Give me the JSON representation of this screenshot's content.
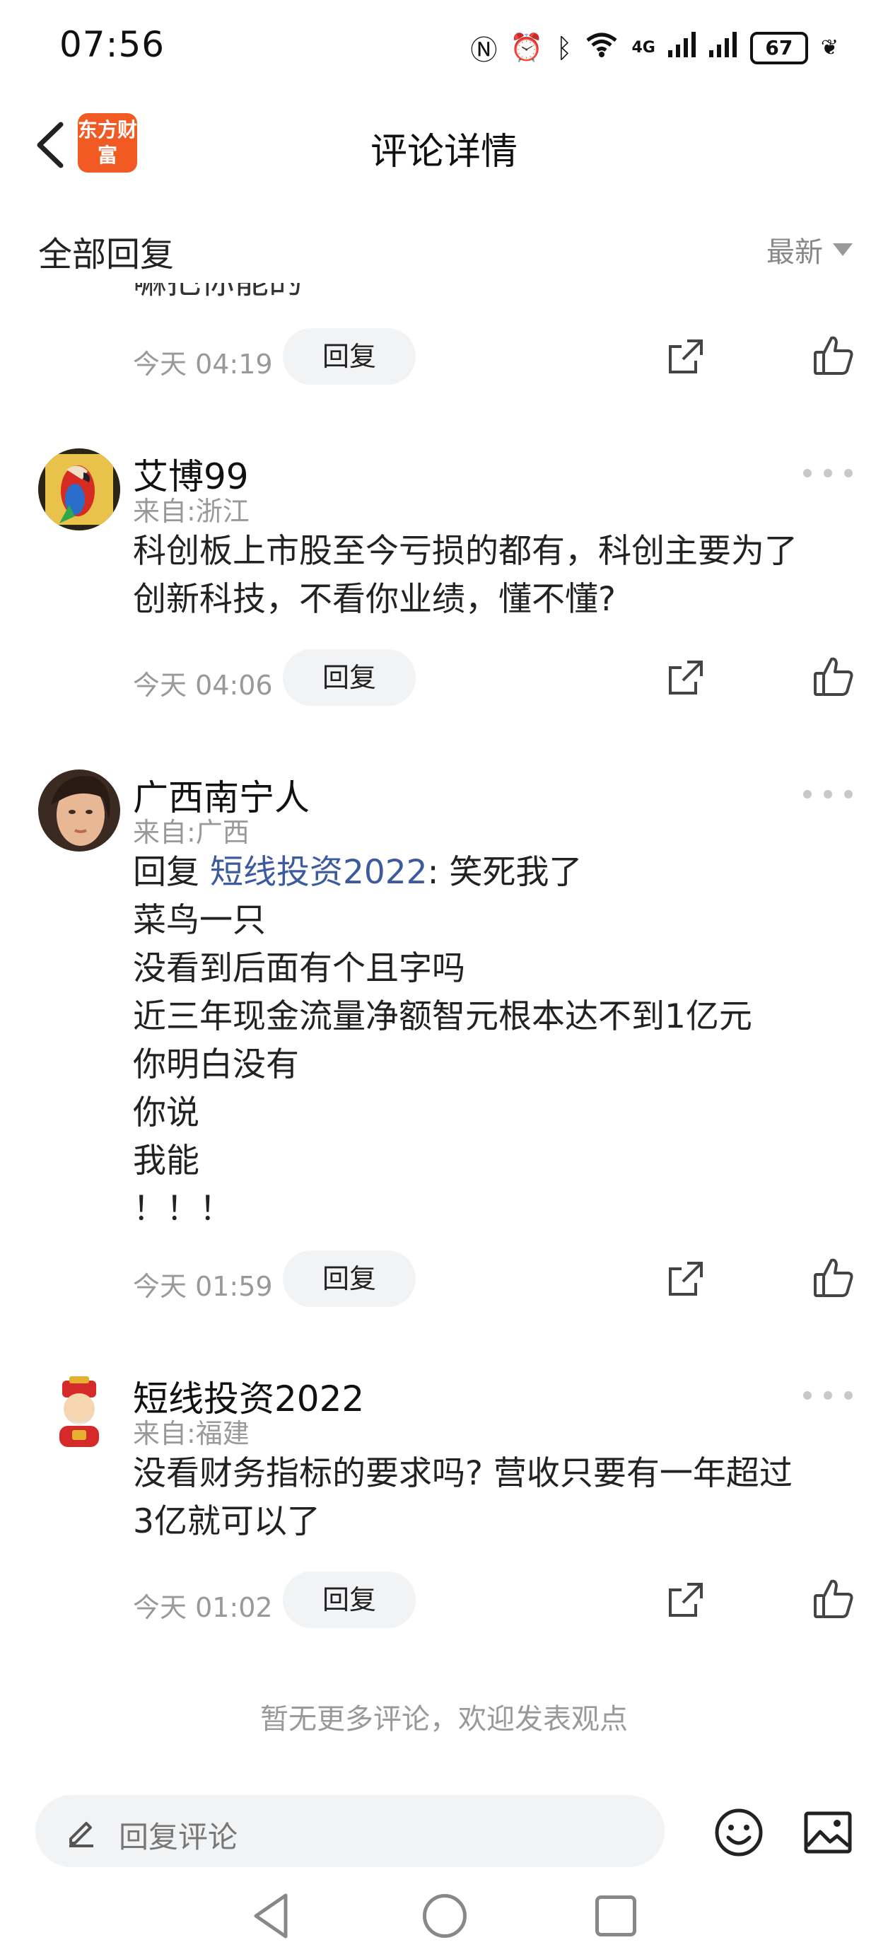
{
  "status_bar": {
    "time": "07:56",
    "network": "4G",
    "battery": "67"
  },
  "header": {
    "title": "评论详情",
    "app_logo_text": "东方财富"
  },
  "sort_bar": {
    "section_title": "全部回复",
    "sort_label": "最新"
  },
  "partial_comment": {
    "text": "嘛把你能的",
    "time": "今天 04:19",
    "reply_label": "回复"
  },
  "comments": [
    {
      "user": "艾博99",
      "location": "来自:浙江",
      "lines": [
        "科创板上市股至今亏损的都有，科创主要为了",
        "创新科技，不看你业绩，懂不懂?"
      ],
      "time": "今天 04:06",
      "reply_label": "回复"
    },
    {
      "user": "广西南宁人",
      "location": "来自:广西",
      "reply_prefix": " 回复 ",
      "reply_target": "短线投资2022",
      "reply_rest": ":  笑死我了",
      "lines": [
        "菜鸟一只",
        "没看到后面有个且字吗",
        "近三年现金流量净额智元根本达不到1亿元",
        "你明白没有",
        "你说",
        "我能",
        "！！！"
      ],
      "time": "今天 01:59",
      "reply_label": "回复"
    },
    {
      "user": "短线投资2022",
      "location": "来自:福建",
      "lines": [
        "没看财务指标的要求吗? 营收只要有一年超过",
        "3亿就可以了"
      ],
      "time": "今天 01:02",
      "reply_label": "回复"
    }
  ],
  "footer_note": "暂无更多评论，欢迎发表观点",
  "bottom_bar": {
    "input_placeholder": "回复评论"
  },
  "colors": {
    "brand": "#f15a22",
    "link": "#3d5a9e",
    "muted": "#999999",
    "pill": "#f2f3f5"
  }
}
